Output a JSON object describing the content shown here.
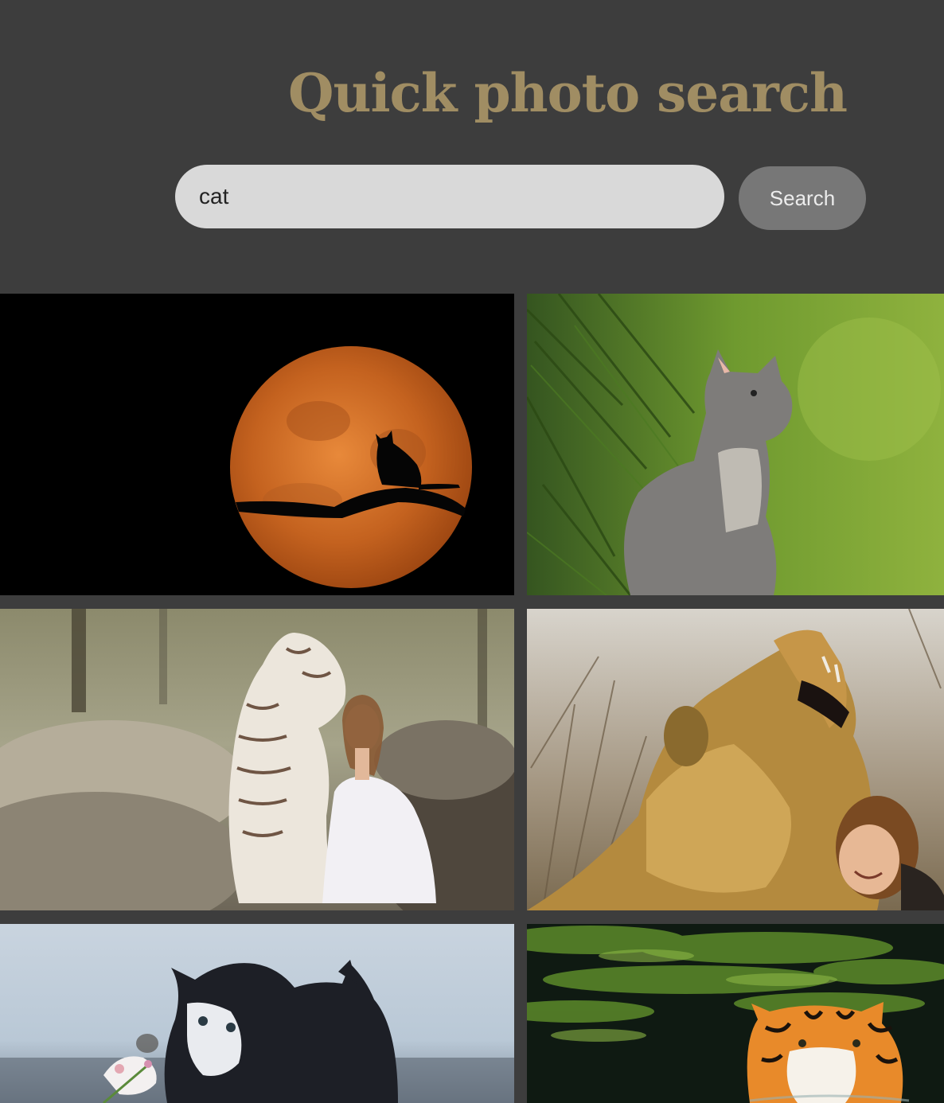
{
  "header": {
    "title": "Quick photo search"
  },
  "search": {
    "value": "cat",
    "button_label": "Search"
  },
  "colors": {
    "background": "#3d3d3d",
    "title": "#a08d63",
    "input_bg": "#d9d9d9",
    "button_bg": "#777777"
  },
  "results": [
    {
      "subject": "cat-silhouette-moon"
    },
    {
      "subject": "gray-kitten-forest"
    },
    {
      "subject": "white-tiger-woman"
    },
    {
      "subject": "lion-girl"
    },
    {
      "subject": "kitten-flower"
    },
    {
      "subject": "tiger-water"
    }
  ]
}
